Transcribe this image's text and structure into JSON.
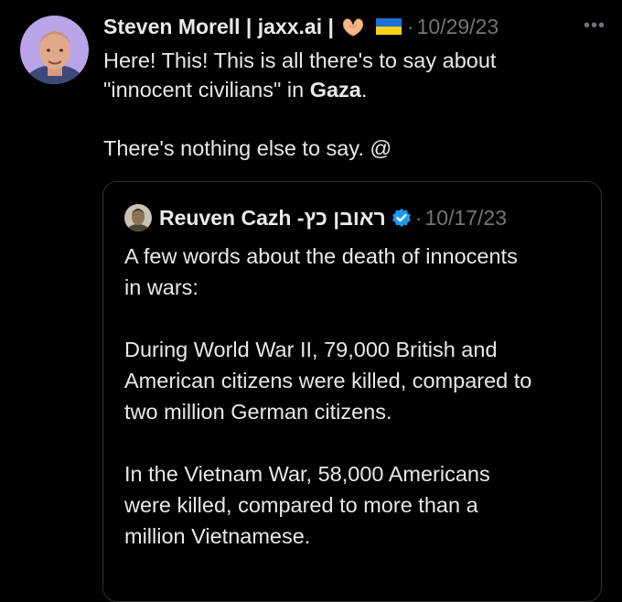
{
  "tweet": {
    "author": "Steven Morell | jaxx.ai |",
    "hands_emoji": "heart-hands-emoji",
    "flag_emoji": "ukraine-flag-emoji",
    "dot": "·",
    "time": "10/29/23",
    "more": "•••",
    "line1": "Here! This! This is all there's to say about",
    "line2_pre": "\"innocent civilians\" in ",
    "line2_bold": "Gaza",
    "line2_post": ".",
    "line3": "There's nothing else to say. @"
  },
  "quote": {
    "author": "Reuven Cazh - ",
    "author_hebrew": "ראובן כץ",
    "dot": "·",
    "time": "10/17/23",
    "para1_l1": "A few words about the death of innocents",
    "para1_l2": "in wars:",
    "para2_l1": "During World War II, 79,000 British and",
    "para2_l2": "American citizens were killed, compared to",
    "para2_l3": "two million German citizens.",
    "para3_l1": "In the Vietnam War, 58,000 Americans",
    "para3_l2": "were killed, compared to more than a",
    "para3_l3": "million Vietnamese."
  },
  "colors": {
    "background": "#000000",
    "text": "#e7e9ea",
    "muted": "#71767b",
    "border": "#2f3336",
    "verified": "#1d9bf0"
  }
}
